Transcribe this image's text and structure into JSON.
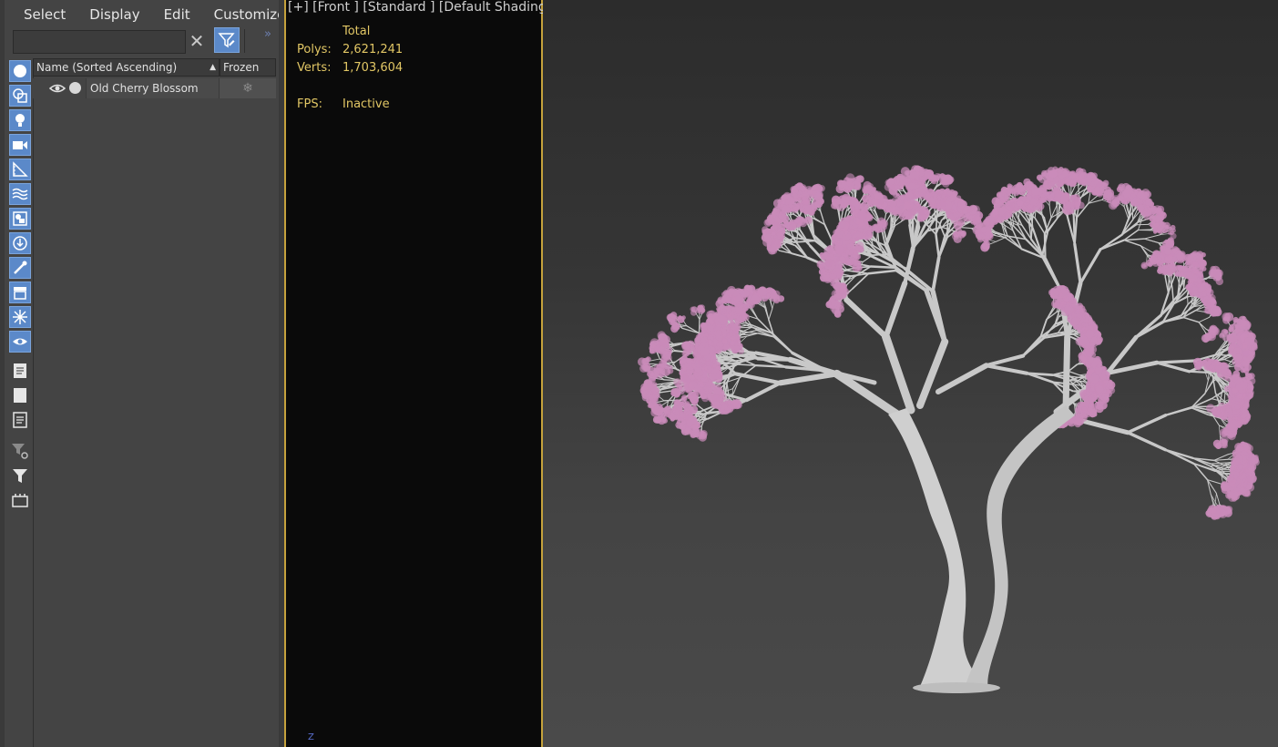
{
  "menu": {
    "items": [
      {
        "label": "Select"
      },
      {
        "label": "Display"
      },
      {
        "label": "Edit"
      },
      {
        "label": "Customize"
      }
    ]
  },
  "search": {
    "value": "",
    "placeholder": ""
  },
  "columns": {
    "name": "Name (Sorted Ascending)",
    "frozen": "Frozen"
  },
  "rows": [
    {
      "name": "Old Cherry Blossom",
      "frozen_icon": "❄"
    }
  ],
  "viewport": {
    "label": "[+] [Front ] [Standard ] [Default Shading ]",
    "stats": {
      "total_label": "Total",
      "polys_label": "Polys:",
      "polys_value": "2,621,241",
      "verts_label": "Verts:",
      "verts_value": "1,703,604",
      "fps_label": "FPS:",
      "fps_value": "Inactive"
    },
    "axis_label": "Z"
  },
  "colors": {
    "accent": "#5b89c9",
    "viewport_border": "#c5a23c",
    "stats_text": "#e2c765",
    "blossom": "#c98bb9"
  }
}
